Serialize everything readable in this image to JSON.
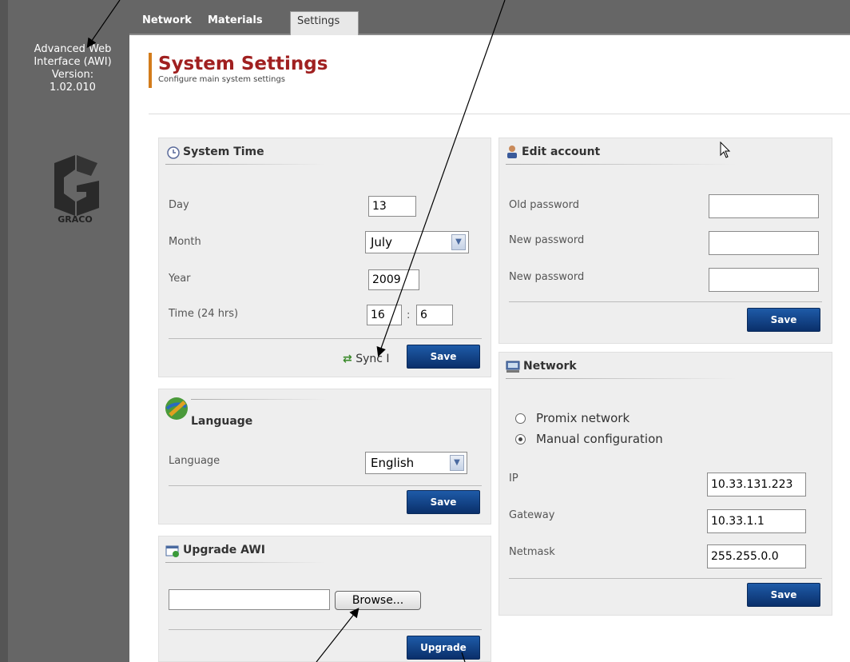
{
  "app": {
    "version_block": [
      "Advanced Web",
      "Interface (AWI)",
      "Version:",
      "1.02.010"
    ],
    "logo_text": "GRACO"
  },
  "tabs": [
    {
      "label": "Network"
    },
    {
      "label": "Materials"
    },
    {
      "label": "Settings"
    }
  ],
  "page": {
    "title": "System Settings",
    "subtitle": "Configure main system settings"
  },
  "system_time": {
    "title": "System Time",
    "day_label": "Day",
    "day_value": "13",
    "month_label": "Month",
    "month_value": "July",
    "year_label": "Year",
    "year_value": "2009",
    "time_label": "Time (24 hrs)",
    "hour_value": "16",
    "minute_value": "6",
    "colon": ":",
    "sync_label": "Sync I",
    "save_label": "Save"
  },
  "language": {
    "title": "Language",
    "label": "Language",
    "value": "English",
    "save_label": "Save"
  },
  "upgrade": {
    "title": "Upgrade AWI",
    "file_value": "",
    "browse_label": "Browse...",
    "upgrade_label": "Upgrade"
  },
  "edit_account": {
    "title": "Edit account",
    "old_label": "Old password",
    "new_label": "New password",
    "confirm_label": "New password",
    "save_label": "Save"
  },
  "network": {
    "title": "Network",
    "option1": "Promix network",
    "option2": "Manual configuration",
    "selected": "Manual configuration",
    "ip_label": "IP",
    "ip_value": "10.33.131.223",
    "gateway_label": "Gateway",
    "gateway_value": "10.33.1.1",
    "netmask_label": "Netmask",
    "netmask_value": "255.255.0.0",
    "save_label": "Save"
  },
  "colors": {
    "title_red": "#a02020",
    "accent_orange": "#d37c1b",
    "button_blue": "#0a2f6a",
    "sidebar_gray": "#666666"
  }
}
